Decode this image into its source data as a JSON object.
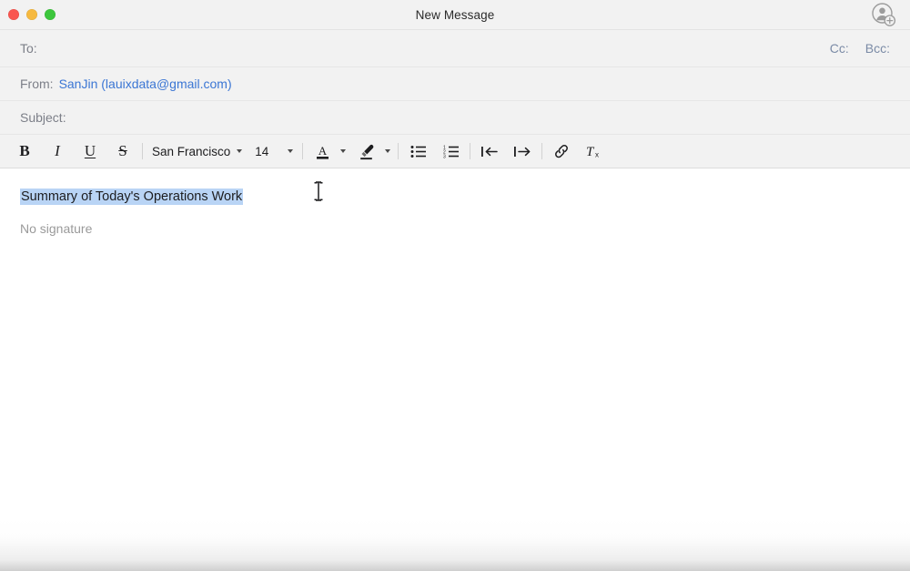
{
  "window": {
    "title": "New Message",
    "traffic_lights": [
      {
        "name": "close",
        "color": "#f9564f"
      },
      {
        "name": "minimize",
        "color": "#f6b93f"
      },
      {
        "name": "zoom",
        "color": "#3cc63c"
      }
    ],
    "add_contact_icon": "person-add-icon"
  },
  "header": {
    "to": {
      "label": "To:",
      "value": "",
      "placeholder": ""
    },
    "cc": {
      "label": "Cc:"
    },
    "bcc": {
      "label": "Bcc:"
    },
    "from": {
      "label": "From:",
      "value": "SanJin (lauixdata@gmail.com)",
      "value_color": "#3b76d4"
    },
    "subject": {
      "label": "Subject:",
      "value": "",
      "placeholder": ""
    }
  },
  "toolbar": {
    "bold": "B",
    "italic": "I",
    "underline": "U",
    "strikethrough": "S",
    "font_family": "San Francisco",
    "font_size": "14",
    "text_color_letter": "A",
    "items": [
      {
        "name": "bold-button",
        "label": "B"
      },
      {
        "name": "italic-button",
        "label": "I"
      },
      {
        "name": "underline-button",
        "label": "U"
      },
      {
        "name": "strikethrough-button",
        "label": "S"
      },
      {
        "name": "font-family-select",
        "label": "San Francisco"
      },
      {
        "name": "font-size-select",
        "label": "14"
      },
      {
        "name": "text-color-button",
        "label": "A"
      },
      {
        "name": "highlight-color-button",
        "label": "highlighter-icon"
      },
      {
        "name": "bulleted-list-button",
        "label": "bulleted-list-icon"
      },
      {
        "name": "numbered-list-button",
        "label": "numbered-list-icon"
      },
      {
        "name": "outdent-button",
        "label": "outdent-icon"
      },
      {
        "name": "indent-button",
        "label": "indent-icon"
      },
      {
        "name": "insert-link-button",
        "label": "link-icon"
      },
      {
        "name": "clear-formatting-button",
        "label": "clear-formatting-icon"
      }
    ]
  },
  "body": {
    "message_text": "Summary of Today's Operations Work",
    "selection_color": "#b9d4f5",
    "signature": "No signature"
  }
}
